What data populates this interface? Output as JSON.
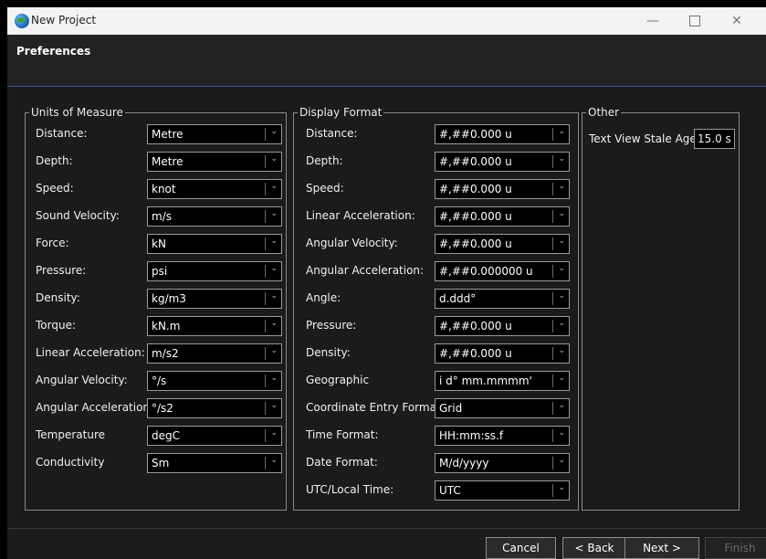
{
  "window": {
    "title": "New Project",
    "icon": "globe-icon"
  },
  "header": {
    "title": "Preferences"
  },
  "units": {
    "legend": "Units of Measure",
    "rows": [
      {
        "label": "Distance:",
        "value": "Metre"
      },
      {
        "label": "Depth:",
        "value": "Metre"
      },
      {
        "label": "Speed:",
        "value": "knot"
      },
      {
        "label": "Sound Velocity:",
        "value": "m/s"
      },
      {
        "label": "Force:",
        "value": "kN"
      },
      {
        "label": "Pressure:",
        "value": "psi"
      },
      {
        "label": "Density:",
        "value": "kg/m3"
      },
      {
        "label": "Torque:",
        "value": "kN.m"
      },
      {
        "label": "Linear Acceleration:",
        "value": "m/s2"
      },
      {
        "label": "Angular Velocity:",
        "value": "°/s"
      },
      {
        "label": "Angular Acceleration:",
        "value": "°/s2"
      },
      {
        "label": "Temperature",
        "value": "degC"
      },
      {
        "label": "Conductivity",
        "value": "Sm"
      }
    ]
  },
  "display": {
    "legend": "Display Format",
    "rows": [
      {
        "label": "Distance:",
        "value": "#,##0.000 u"
      },
      {
        "label": "Depth:",
        "value": "#,##0.000 u"
      },
      {
        "label": "Speed:",
        "value": "#,##0.000 u"
      },
      {
        "label": "Linear Acceleration:",
        "value": "#,##0.000 u"
      },
      {
        "label": "Angular Velocity:",
        "value": "#,##0.000 u"
      },
      {
        "label": "Angular Acceleration:",
        "value": "#,##0.000000 u"
      },
      {
        "label": "Angle:",
        "value": "d.ddd°"
      },
      {
        "label": "Pressure:",
        "value": "#,##0.000 u"
      },
      {
        "label": "Density:",
        "value": "#,##0.000 u"
      },
      {
        "label": "Geographic",
        "value": "i d° mm.mmmm'"
      },
      {
        "label": "Coordinate Entry Format:",
        "value": "Grid"
      },
      {
        "label": "Time Format:",
        "value": "HH:mm:ss.f"
      },
      {
        "label": "Date Format:",
        "value": "M/d/yyyy"
      },
      {
        "label": "UTC/Local Time:",
        "value": "UTC"
      }
    ]
  },
  "other": {
    "legend": "Other",
    "stale_label": "Text View Stale Age:",
    "stale_value": "15.0 s"
  },
  "footer": {
    "cancel": "Cancel",
    "back": "< Back",
    "next": "Next >",
    "finish": "Finish"
  }
}
